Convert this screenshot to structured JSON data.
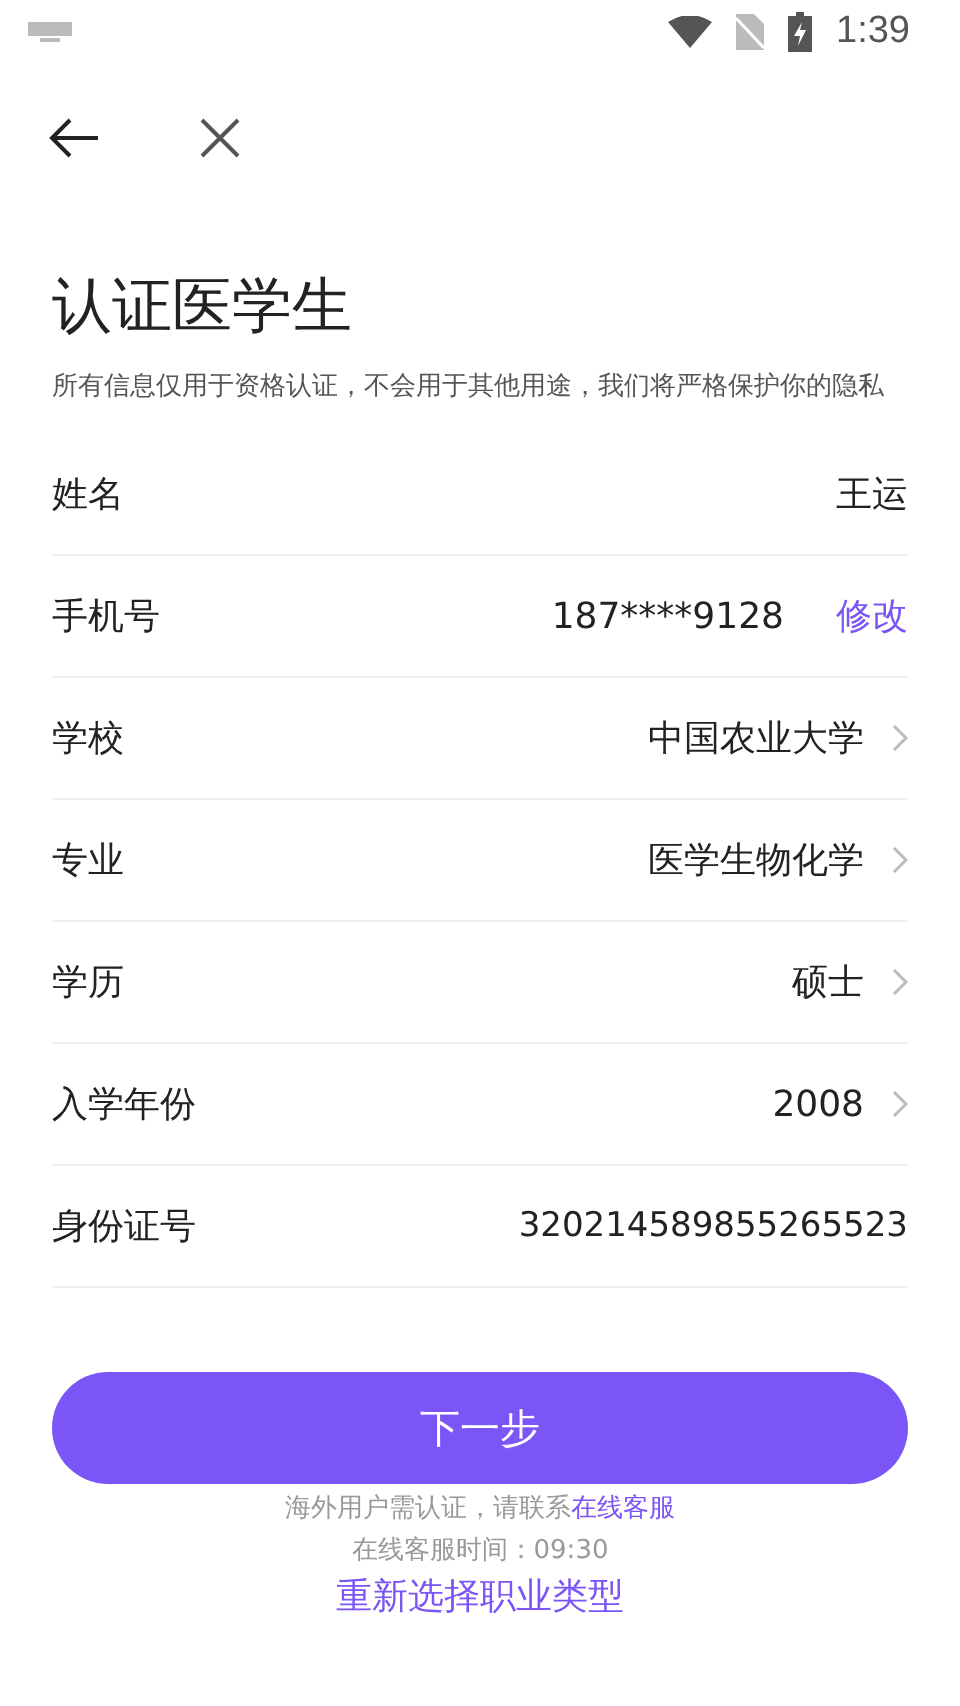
{
  "status_bar": {
    "time": "1:39"
  },
  "title": "认证医学生",
  "subtitle": "所有信息仅用于资格认证，不会用于其他用途，我们将严格保护你的隐私",
  "fields": [
    {
      "kind": "text",
      "label": "姓名",
      "value": "王运"
    },
    {
      "kind": "action",
      "label": "手机号",
      "value": "187****9128",
      "action": "修改"
    },
    {
      "kind": "select",
      "label": "学校",
      "value": "中国农业大学"
    },
    {
      "kind": "select",
      "label": "专业",
      "value": "医学生物化学"
    },
    {
      "kind": "select",
      "label": "学历",
      "value": "硕士"
    },
    {
      "kind": "select",
      "label": "入学年份",
      "value": "2008"
    },
    {
      "kind": "input",
      "label": "身份证号",
      "value": "320214589855265523"
    }
  ],
  "next_button": "下一步",
  "notice": {
    "text": "海外用户需认证，请联系",
    "link": "在线客服"
  },
  "service_hours": "在线客服时间：09:30",
  "reselect_link": "重新选择职业类型"
}
